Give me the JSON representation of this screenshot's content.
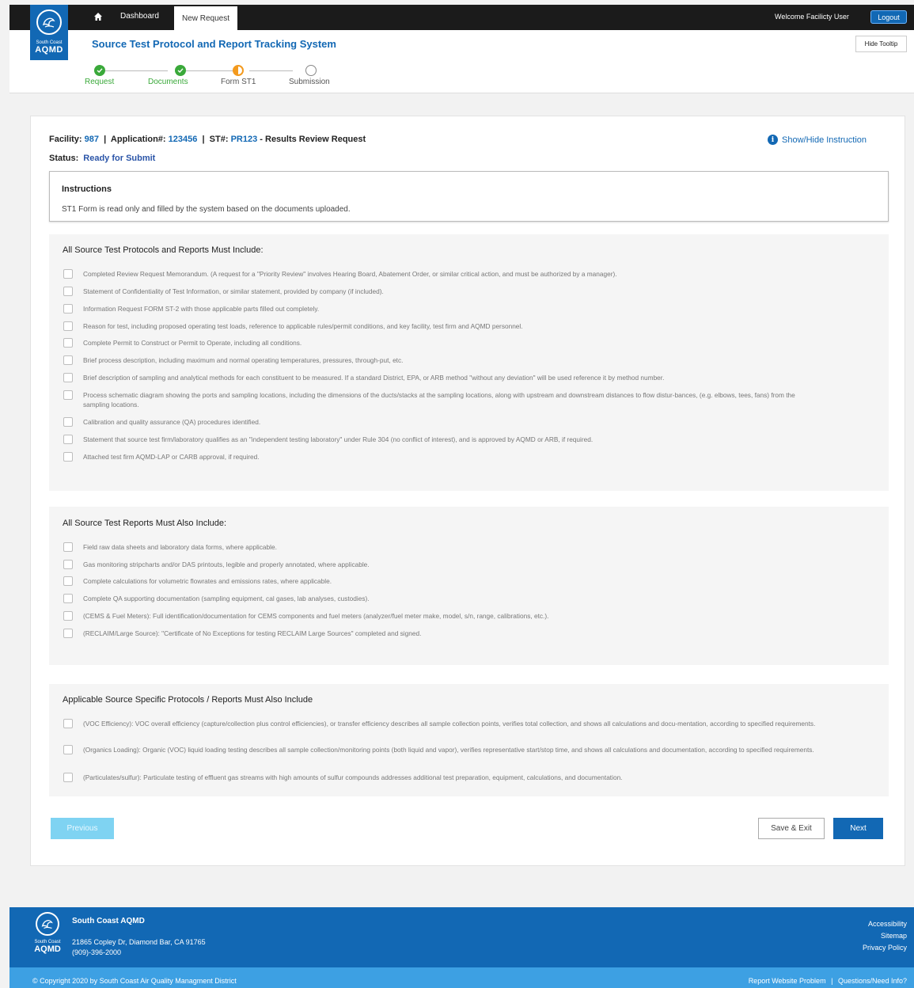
{
  "colors": {
    "brand": "#1268b4",
    "success": "#3aa93a",
    "current": "#f39a1e",
    "topbar": "#1b1b1b"
  },
  "logo": {
    "small_text": "South Coast",
    "big_text": "AQMD"
  },
  "nav": {
    "home_icon": "home-icon",
    "dashboard": "Dashboard",
    "new_request": "New Request",
    "welcome": "Welcome Facilicty User",
    "logout": "Logout"
  },
  "header": {
    "title": "Source Test Protocol and Report Tracking System",
    "hide_tooltip": "Hide Tooltip"
  },
  "steps": [
    {
      "label": "Request",
      "state": "done"
    },
    {
      "label": "Documents",
      "state": "done"
    },
    {
      "label": "Form ST1",
      "state": "current"
    },
    {
      "label": "Submission",
      "state": "todo"
    }
  ],
  "summary": {
    "facility_label": "Facility:",
    "facility": "987",
    "app_label": "Application#:",
    "app": "123456",
    "st_label": "ST#:",
    "st": "PR123",
    "suffix": "- Results Review Request",
    "status_label": "Status:",
    "status": "Ready for Submit",
    "show_hide": "Show/Hide Instruction"
  },
  "instructions": {
    "title": "Instructions",
    "text": "ST1 Form is read only and filled by the system based on the documents uploaded."
  },
  "sections": [
    {
      "title": "All Source Test Protocols and Reports Must Include:",
      "items": [
        "Completed Review Request Memorandum. (A request for a \"Priority Review\" involves Hearing Board, Abatement Order, or similar critical action, and must be authorized by a manager).",
        "Statement of Confidentiality of Test Information, or similar statement, provided by company (if included).",
        "Information Request FORM ST-2 with those applicable parts filled out completely.",
        "Reason for test, including proposed operating test loads, reference to applicable rules/permit conditions, and key facility, test firm and AQMD personnel.",
        "Complete Permit to Construct or Permit to Operate, including all conditions.",
        "Brief process description, including maximum and normal operating temperatures, pressures, through-put, etc.",
        "Brief description of sampling and analytical methods for each constituent to be measured. If a standard District, EPA, or ARB method \"without any deviation\" will be used reference it by method number.",
        "Process schematic diagram showing the ports and sampling locations, including the dimensions of the ducts/stacks at the sampling locations, along with upstream and downstream distances to flow distur-bances, (e.g. elbows, tees, fans) from the sampling locations.",
        "Calibration and quality assurance (QA) procedures identified.",
        "Statement that source test firm/laboratory qualifies as an \"independent testing laboratory\" under Rule 304 (no conflict of interest), and is approved by AQMD or ARB, if required.",
        "Attached test firm AQMD-LAP or CARB approval, if required."
      ]
    },
    {
      "title": "All Source Test Reports Must Also Include:",
      "items": [
        "Field raw data sheets and laboratory data forms, where applicable.",
        "Gas monitoring stripcharts and/or DAS printouts, legible and properly annotated, where applicable.",
        "Complete calculations for volumetric flowrates and emissions rates, where applicable.",
        "Complete QA supporting documentation (sampling equipment, cal gases, lab analyses, custodies).",
        "(CEMS & Fuel Meters): Full identification/documentation for CEMS components and fuel meters (analyzer/fuel meter make, model, s/n, range, calibrations, etc.).",
        "(RECLAIM/Large Source): \"Certificate of No Exceptions for testing RECLAIM Large Sources\" completed and signed."
      ]
    },
    {
      "title": "Applicable Source Specific Protocols / Reports Must Also Include",
      "items": [
        "(VOC Efficiency): VOC overall efficiency (capture/collection plus control efficiencies), or transfer efficiency describes all sample collection points, verifies total collection, and shows all calculations and docu-mentation, according to specified requirements.",
        "(Organics Loading): Organic (VOC) liquid loading testing describes all sample collection/monitoring points (both liquid and vapor), verifies representative start/stop time, and shows all calculations and documentation, according to specified requirements.",
        "(Particulates/sulfur): Particulate testing of effluent gas streams with high amounts of sulfur compounds addresses additional test preparation, equipment, calculations, and documentation."
      ]
    }
  ],
  "buttons": {
    "previous": "Previous",
    "save_exit": "Save & Exit",
    "next": "Next"
  },
  "footer": {
    "name": "South Coast AQMD",
    "address": "21865 Copley Dr, Diamond Bar, CA 91765",
    "phone": "(909)-396-2000",
    "links": [
      "Accessibility",
      "Sitemap",
      "Privacy Policy"
    ],
    "copyright": "© Copyright 2020 by South Coast Air Quality Managment District",
    "report": "Report Website Problem",
    "separator": "|",
    "questions": "Questions/Need Info?"
  }
}
